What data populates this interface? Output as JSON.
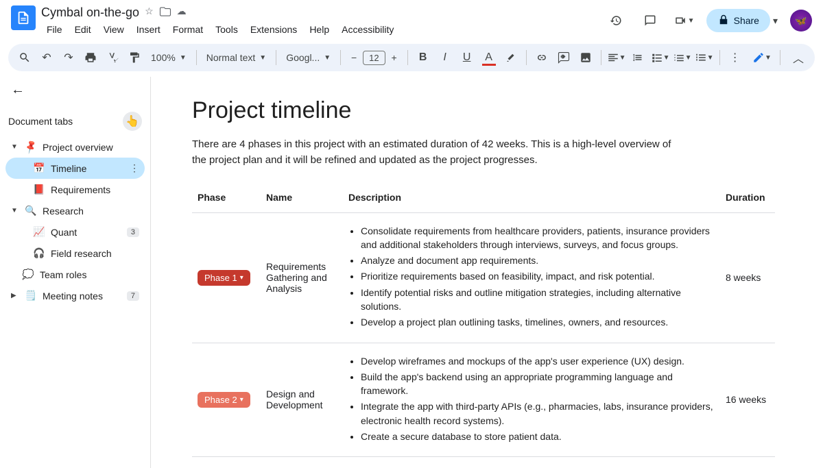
{
  "header": {
    "title": "Cymbal on-the-go",
    "menu": [
      "File",
      "Edit",
      "View",
      "Insert",
      "Format",
      "Tools",
      "Extensions",
      "Help",
      "Accessibility"
    ],
    "share_label": "Share"
  },
  "toolbar": {
    "zoom": "100%",
    "style": "Normal text",
    "font": "Googl...",
    "font_size": "12"
  },
  "sidebar": {
    "header": "Document tabs",
    "items": [
      {
        "label": "Project overview"
      },
      {
        "label": "Timeline"
      },
      {
        "label": "Requirements"
      },
      {
        "label": "Research"
      },
      {
        "label": "Quant",
        "badge": "3"
      },
      {
        "label": "Field research"
      },
      {
        "label": "Team roles"
      },
      {
        "label": "Meeting notes",
        "badge": "7"
      }
    ]
  },
  "doc": {
    "h1": "Project timeline",
    "para": "There are 4 phases in this project with an estimated duration of 42 weeks. This is a high-level overview of the project plan and it will be refined and updated as the project progresses.",
    "columns": [
      "Phase",
      "Name",
      "Description",
      "Duration"
    ],
    "rows": [
      {
        "phase": "Phase 1",
        "name": "Requirements Gathering and Analysis",
        "desc": [
          "Consolidate requirements from healthcare providers, patients, insurance providers and additional stakeholders through interviews, surveys, and focus groups.",
          "Analyze and document app requirements.",
          "Prioritize requirements based on feasibility, impact, and risk potential.",
          "Identify potential risks and outline mitigation strategies, including alternative solutions.",
          "Develop a project plan outlining tasks, timelines, owners, and resources."
        ],
        "duration": "8 weeks"
      },
      {
        "phase": "Phase 2",
        "name": "Design and Development",
        "desc": [
          "Develop wireframes and mockups of the app's user experience (UX) design.",
          "Build the app's backend using an appropriate programming language and framework.",
          "Integrate the app with third-party APIs (e.g., pharmacies, labs, insurance providers, electronic health record systems).",
          "Create a secure database to store patient data."
        ],
        "duration": "16 weeks"
      }
    ]
  }
}
